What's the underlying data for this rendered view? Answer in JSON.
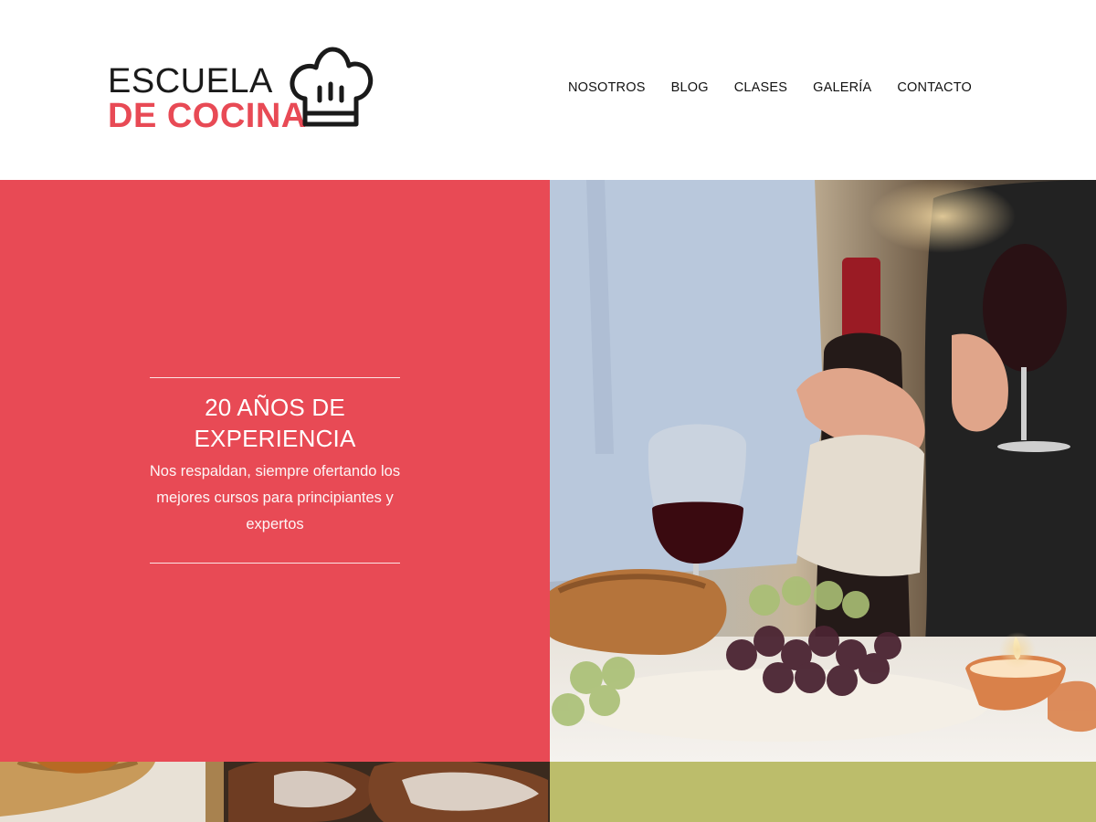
{
  "logo": {
    "line1": "ESCUELA",
    "line2": "DE COCINA",
    "icon": "chef-hat-icon",
    "accent_color": "#e84a55"
  },
  "nav": {
    "items": [
      {
        "label": "NOSOTROS"
      },
      {
        "label": "BLOG"
      },
      {
        "label": "CLASES"
      },
      {
        "label": "GALERÍA"
      },
      {
        "label": "CONTACTO"
      }
    ]
  },
  "hero": {
    "title_line1": "20 AÑOS DE",
    "title_line2": "EXPERIENCIA",
    "description": "Nos respaldan, siempre ofertando los mejores cursos para principiantes y expertos",
    "background_color": "#e84a55",
    "image": "wine-dinner-photo"
  },
  "strips": {
    "left_image": "bread-basket-photo",
    "right_color": "#bcbd6b"
  }
}
